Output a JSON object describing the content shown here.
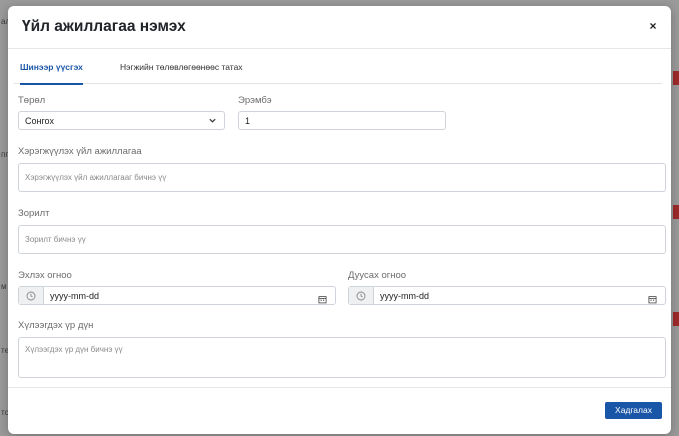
{
  "background": {
    "fragments": [
      "ал",
      "пп",
      "м",
      "те",
      "тс"
    ]
  },
  "modal": {
    "title": "Үйл ажиллагаа нэмэх",
    "close_label": "×",
    "tabs": [
      {
        "label": "Шинээр үүсгэх",
        "active": true
      },
      {
        "label": "Нэгжийн төлөвлөгөөнөөс татах",
        "active": false
      }
    ],
    "form": {
      "type": {
        "label": "Төрөл",
        "value": "Сонгох"
      },
      "order": {
        "label": "Эрэмбэ",
        "value": "1"
      },
      "activity": {
        "label": "Хэрэгжүүлэх үйл ажиллагаа",
        "placeholder": "Хэрэгжүүлэх үйл ажиллагааг бичнэ үү"
      },
      "goal": {
        "label": "Зорилт",
        "placeholder": "Зорилт бичнэ үү"
      },
      "start_date": {
        "label": "Эхлэх огноо",
        "placeholder": "yyyy-mm-dd"
      },
      "end_date": {
        "label": "Дуусах огноо",
        "placeholder": "yyyy-mm-dd"
      },
      "expected_result": {
        "label": "Хүлээгдэх үр дүн",
        "placeholder": "Хүлээгдэх үр дүн бичнэ үү"
      }
    },
    "save_label": "Хадгалах"
  },
  "colors": {
    "accent": "#1a56a8",
    "overlay": "#9a9a9a"
  }
}
